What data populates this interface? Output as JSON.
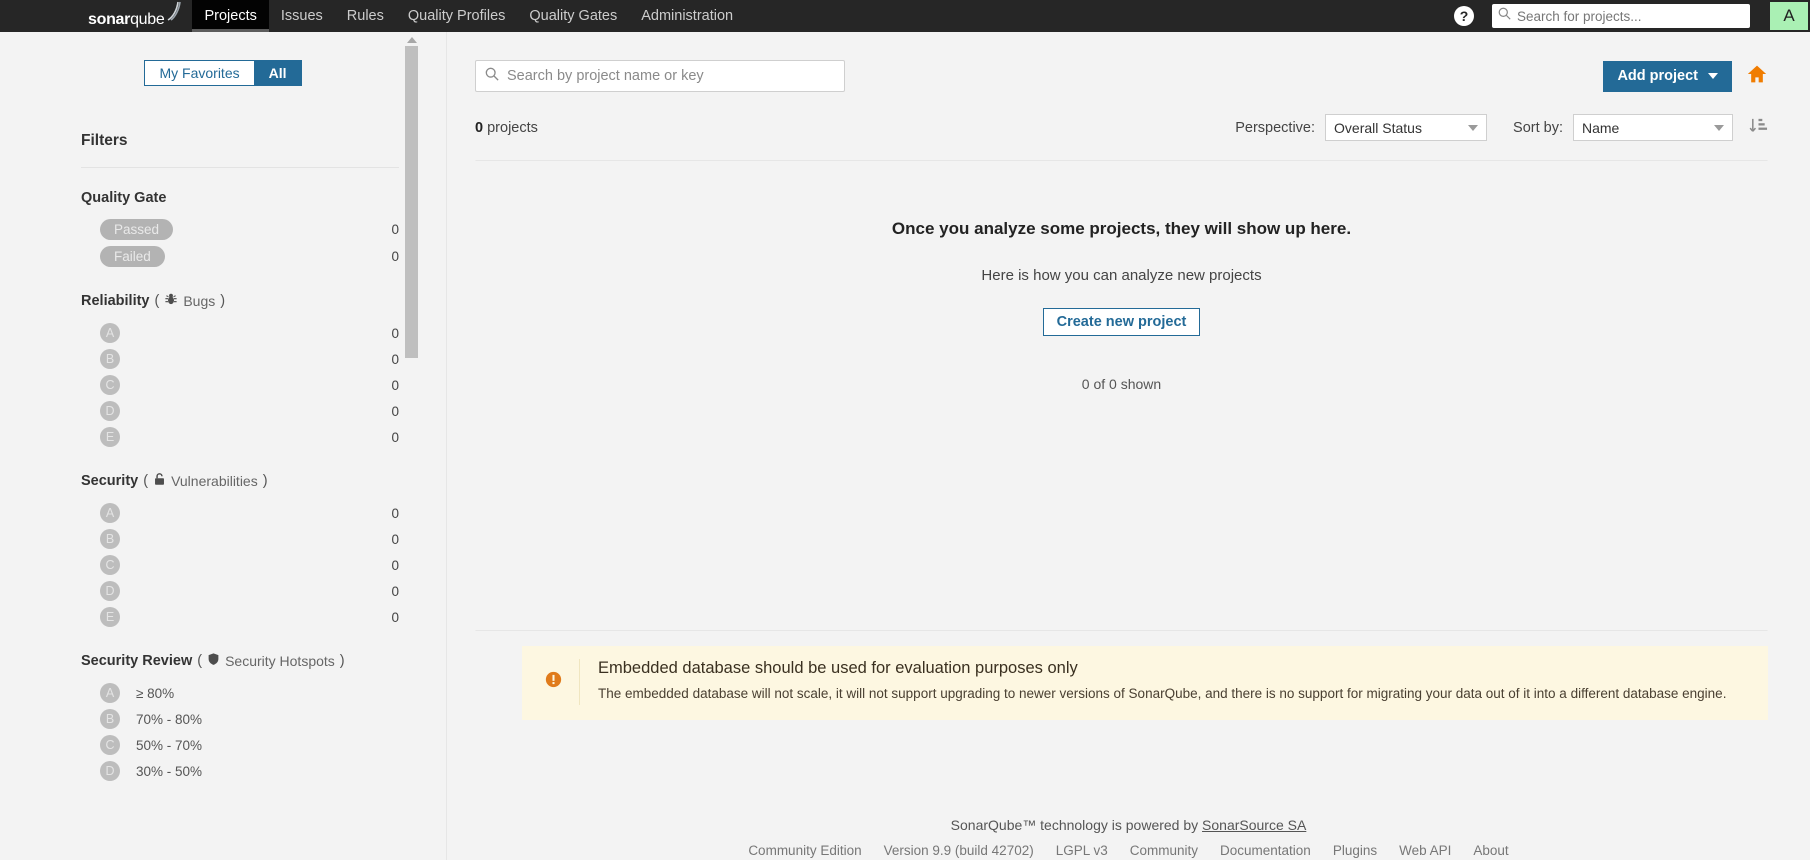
{
  "topnav": {
    "logo": {
      "bold": "sonar",
      "light": "qube"
    },
    "tabs": [
      {
        "label": "Projects",
        "active": true
      },
      {
        "label": "Issues",
        "active": false
      },
      {
        "label": "Rules",
        "active": false
      },
      {
        "label": "Quality Profiles",
        "active": false
      },
      {
        "label": "Quality Gates",
        "active": false
      },
      {
        "label": "Administration",
        "active": false
      }
    ],
    "help_icon": "question-mark",
    "search": {
      "value": "",
      "placeholder": "Search for projects..."
    },
    "avatar": {
      "initial": "A",
      "color": "#aaf0b4"
    }
  },
  "sidebar": {
    "toggle": {
      "favorites_label": "My Favorites",
      "all_label": "All",
      "selected": "All"
    },
    "filters_title": "Filters",
    "groups": [
      {
        "title": "Quality Gate",
        "type": "pill",
        "rows": [
          {
            "label": "Passed",
            "count": "0"
          },
          {
            "label": "Failed",
            "count": "0"
          }
        ]
      },
      {
        "title": "Reliability",
        "sub": "Bugs",
        "icon": "bug-icon",
        "type": "rating",
        "rows": [
          {
            "label": "A",
            "count": "0"
          },
          {
            "label": "B",
            "count": "0"
          },
          {
            "label": "C",
            "count": "0"
          },
          {
            "label": "D",
            "count": "0"
          },
          {
            "label": "E",
            "count": "0"
          }
        ]
      },
      {
        "title": "Security",
        "sub": "Vulnerabilities",
        "icon": "lock-icon",
        "type": "rating",
        "rows": [
          {
            "label": "A",
            "count": "0"
          },
          {
            "label": "B",
            "count": "0"
          },
          {
            "label": "C",
            "count": "0"
          },
          {
            "label": "D",
            "count": "0"
          },
          {
            "label": "E",
            "count": "0"
          }
        ]
      },
      {
        "title": "Security Review",
        "sub": "Security Hotspots",
        "icon": "shield-icon",
        "type": "rating-range",
        "rows": [
          {
            "label": "A",
            "range": "≥ 80%",
            "count": ""
          },
          {
            "label": "B",
            "range": "70% - 80%",
            "count": ""
          },
          {
            "label": "C",
            "range": "50% - 70%",
            "count": ""
          },
          {
            "label": "D",
            "range": "30% - 50%",
            "count": ""
          }
        ]
      }
    ]
  },
  "main": {
    "search": {
      "value": "",
      "placeholder": "Search by project name or key"
    },
    "add_project_button": "Add project",
    "home_icon": "home-icon",
    "project_count_number": "0",
    "project_count_label": "projects",
    "perspective_label": "Perspective:",
    "perspective_value": "Overall Status",
    "sort_label": "Sort by:",
    "sort_value": "Name",
    "sort_direction_icon": "sort-descending-icon",
    "empty_title": "Once you analyze some projects, they will show up here.",
    "empty_sub": "Here is how you can analyze new projects",
    "create_button": "Create new project",
    "shown_text": "0 of 0 shown"
  },
  "warning": {
    "icon": "alert-icon",
    "title": "Embedded database should be used for evaluation purposes only",
    "text": "The embedded database will not scale, it will not support upgrading to newer versions of SonarQube, and there is no support for migrating your data out of it into a different database engine."
  },
  "footer": {
    "powered_prefix": "SonarQube™ technology is powered by ",
    "powered_link": "SonarSource SA",
    "edition": "Community Edition",
    "version": "Version 9.9 (build 42702)",
    "license": "LGPL v3",
    "links": [
      "Community",
      "Documentation",
      "Plugins",
      "Web API",
      "About"
    ]
  },
  "colors": {
    "brand_blue": "#236a97",
    "nav_dark": "#262626",
    "warn_bg": "#fdf7e1",
    "warn_accent": "#e07b1b",
    "home_orange": "#f07c00"
  }
}
